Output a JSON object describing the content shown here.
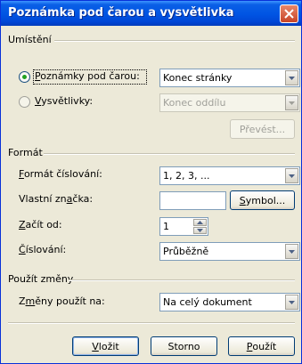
{
  "window": {
    "title": "Poznámka pod čarou a vysvětlivka"
  },
  "location": {
    "group_label": "Umístění",
    "footnotes_label": "Poznámky pod čarou:",
    "footnotes_selected": true,
    "footnotes_value": "Konec stránky",
    "endnotes_label": "Vysvětlivky:",
    "endnotes_selected": false,
    "endnotes_value": "Konec oddílu",
    "convert_label": "Převést..."
  },
  "format": {
    "group_label": "Formát",
    "number_format_label": "Formát číslování:",
    "number_format_value": "1, 2, 3, ...",
    "custom_mark_label": "Vlastní značka:",
    "custom_mark_value": "",
    "symbol_label": "Symbol...",
    "start_at_label": "Začít od:",
    "start_at_value": "1",
    "numbering_label": "Číslování:",
    "numbering_value": "Průběžně"
  },
  "apply": {
    "group_label": "Použít změny",
    "apply_to_label": "Změny použít na:",
    "apply_to_value": "Na celý dokument"
  },
  "buttons": {
    "insert_label": "Vložit",
    "cancel_label": "Storno",
    "apply_label": "Použít"
  }
}
